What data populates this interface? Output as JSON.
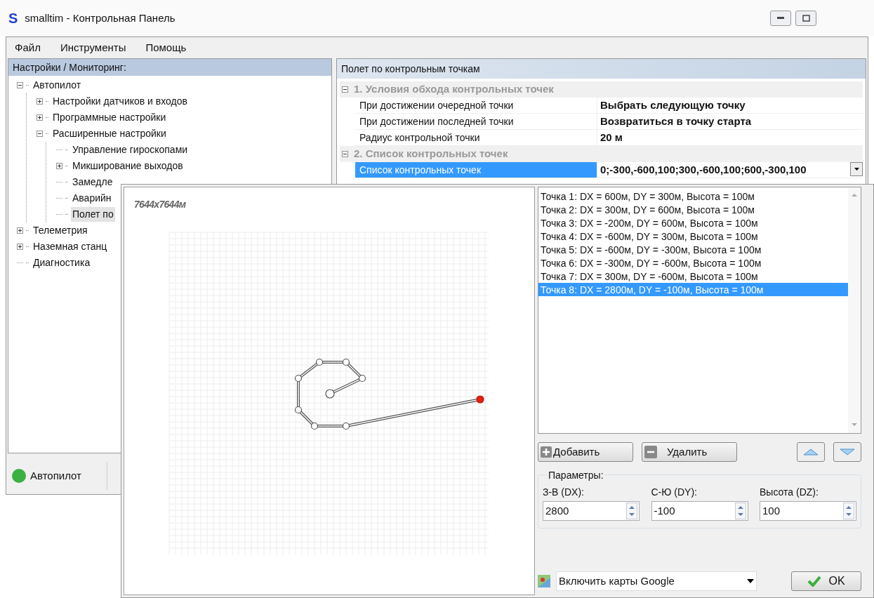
{
  "window": {
    "logo": "S",
    "title": "smalltim - Контрольная Панель"
  },
  "menu": [
    "Файл",
    "Инструменты",
    "Помощь"
  ],
  "tree": {
    "header": "Настройки / Мониторинг:",
    "items": [
      {
        "label": "Автопилот",
        "expanded": true,
        "selected": false,
        "children": [
          {
            "label": "Настройки датчиков и входов",
            "expanded": false,
            "selected": false
          },
          {
            "label": "Программные настройки",
            "expanded": false,
            "selected": false
          },
          {
            "label": "Расширенные настройки",
            "expanded": true,
            "selected": false,
            "children": [
              {
                "label": "Управление гироскопами",
                "selected": false
              },
              {
                "label": "Микширование выходов",
                "expanded": false,
                "selected": false
              },
              {
                "label": "Замедле",
                "selected": false
              },
              {
                "label": "Аварийн",
                "selected": false
              },
              {
                "label": "Полет по",
                "selected": true
              }
            ]
          }
        ]
      },
      {
        "label": "Телеметрия",
        "expanded": false,
        "selected": false
      },
      {
        "label": "Наземная станц",
        "expanded": false,
        "selected": false
      },
      {
        "label": "Диагностика",
        "selected": false
      }
    ]
  },
  "status_bar": [
    {
      "label": "Автопилот",
      "color": "#3cb043"
    }
  ],
  "property_grid": {
    "title": "Полет по контрольным точкам",
    "categories": [
      {
        "label": "1. Условия обхода контрольных точек",
        "expanded": true,
        "rows": [
          {
            "name": "При достижении очередной точки",
            "value": "Выбрать следующую точку",
            "selected": false
          },
          {
            "name": "При достижении последней точки",
            "value": "Возвратиться в точку старта",
            "selected": false
          },
          {
            "name": "Радиус контрольной точки",
            "value": "20 м",
            "selected": false
          }
        ]
      },
      {
        "label": "2. Список контрольных точек",
        "expanded": true,
        "rows": [
          {
            "name": "Список контрольных точек",
            "value": "0;-300,-600,100;300,-600,100;600,-300,100",
            "selected": true
          }
        ]
      }
    ]
  },
  "dialog": {
    "map_label": "7644x7644м",
    "points": [
      {
        "label": "Точка 1: DX = 600м, DY = 300м, Высота = 100м",
        "selected": false
      },
      {
        "label": "Точка 2: DX = 300м, DY = 600м, Высота = 100м",
        "selected": false
      },
      {
        "label": "Точка 3: DX = -200м, DY = 600м, Высота = 100м",
        "selected": false
      },
      {
        "label": "Точка 4: DX = -600м, DY = 300м, Высота = 100м",
        "selected": false
      },
      {
        "label": "Точка 5: DX = -600м, DY = -300м, Высота = 100м",
        "selected": false
      },
      {
        "label": "Точка 6: DX = -300м, DY = -600м, Высота = 100м",
        "selected": false
      },
      {
        "label": "Точка 7: DX = 300м, DY = -600м, Высота = 100м",
        "selected": false
      },
      {
        "label": "Точка 8: DX = 2800м, DY = -100м, Высота = 100м",
        "selected": true
      }
    ],
    "add_button": "Добавить",
    "delete_button": "Удалить",
    "params": {
      "title": "Параметры:",
      "fields": [
        {
          "label": "З-В (DX):",
          "value": "2800"
        },
        {
          "label": "С-Ю (DY):",
          "value": "-100"
        },
        {
          "label": "Высота (DZ):",
          "value": "100"
        }
      ]
    },
    "map_select": "Включить карты Google",
    "ok_button": "OK"
  }
}
